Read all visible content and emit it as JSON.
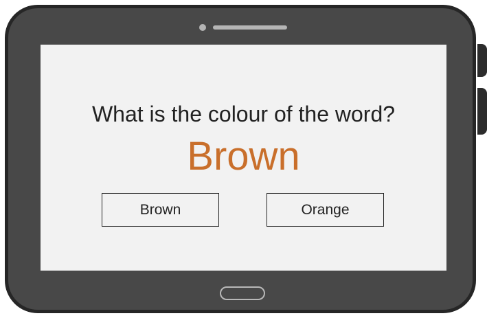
{
  "quiz": {
    "question": "What is the colour of the word?",
    "word": "Brown",
    "word_color": "#c96f2b",
    "options": [
      {
        "label": "Brown"
      },
      {
        "label": "Orange"
      }
    ]
  },
  "device": {
    "type": "tablet",
    "bezel_color": "#484848",
    "screen_color": "#f2f2f2"
  }
}
